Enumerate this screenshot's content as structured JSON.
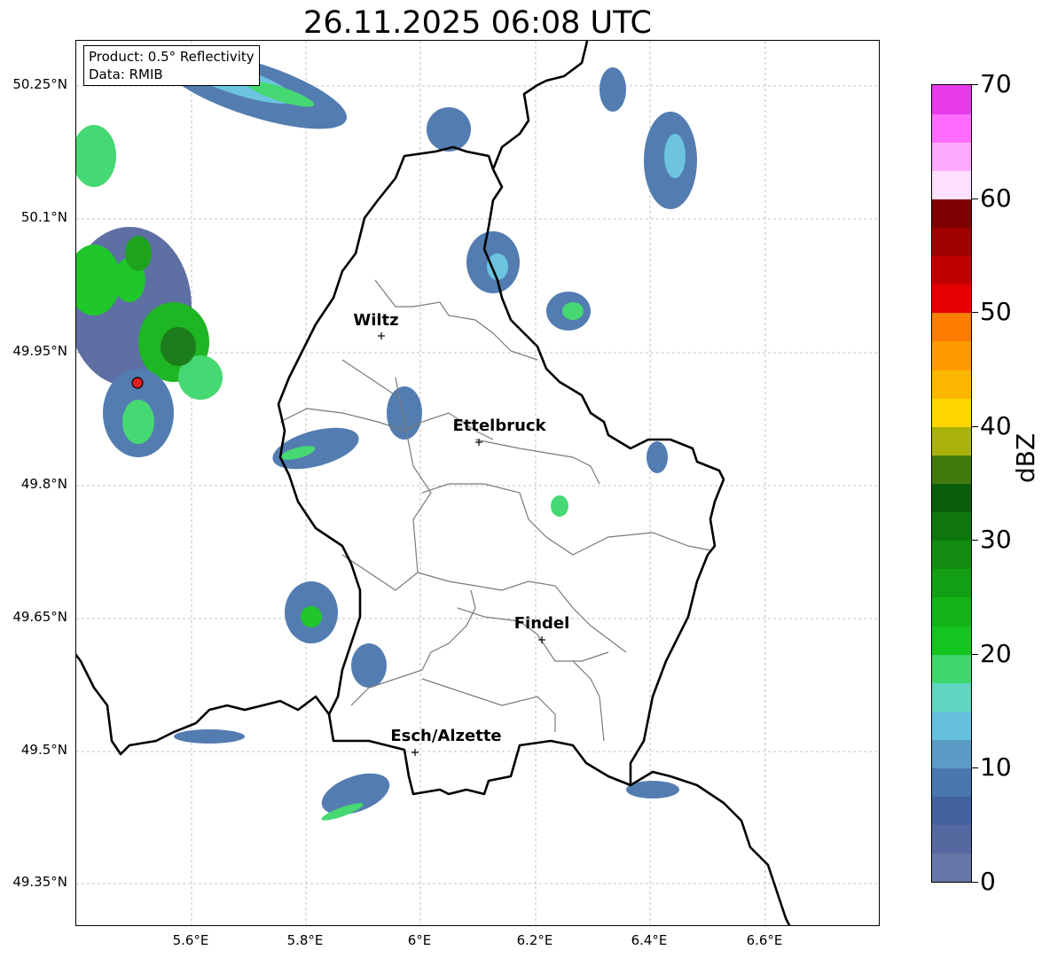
{
  "title": "26.11.2025 06:08 UTC",
  "info_box": {
    "product": "Product: 0.5° Reflectivity",
    "data": "Data: RMIB"
  },
  "lat_ticks": [
    "50.25°N",
    "50.1°N",
    "49.95°N",
    "49.8°N",
    "49.65°N",
    "49.5°N",
    "49.35°N"
  ],
  "lon_ticks": [
    "5.6°E",
    "5.8°E",
    "6°E",
    "6.2°E",
    "6.4°E",
    "6.6°E"
  ],
  "cities": [
    {
      "name": "Wiltz"
    },
    {
      "name": "Ettelbruck"
    },
    {
      "name": "Findel"
    },
    {
      "name": "Esch/Alzette"
    }
  ],
  "colorbar": {
    "label": "dBZ",
    "ticks": [
      "0",
      "10",
      "20",
      "30",
      "40",
      "50",
      "60",
      "70"
    ],
    "colors": [
      "#6577a6",
      "#5668a0",
      "#43609f",
      "#4a77ad",
      "#5b9bc6",
      "#66c1de",
      "#5fd6c0",
      "#3dd66b",
      "#14c51f",
      "#12b319",
      "#129f14",
      "#118c11",
      "#0f760f",
      "#0b5c0b",
      "#437a0d",
      "#a9b20a",
      "#fed700",
      "#fdb600",
      "#fd9a00",
      "#fd7d00",
      "#e40000",
      "#c00000",
      "#a00000",
      "#7c0000",
      "#ffdfff",
      "#ffaaff",
      "#ff6cff",
      "#e73ae9"
    ]
  },
  "radar_site_color": "#e02020"
}
